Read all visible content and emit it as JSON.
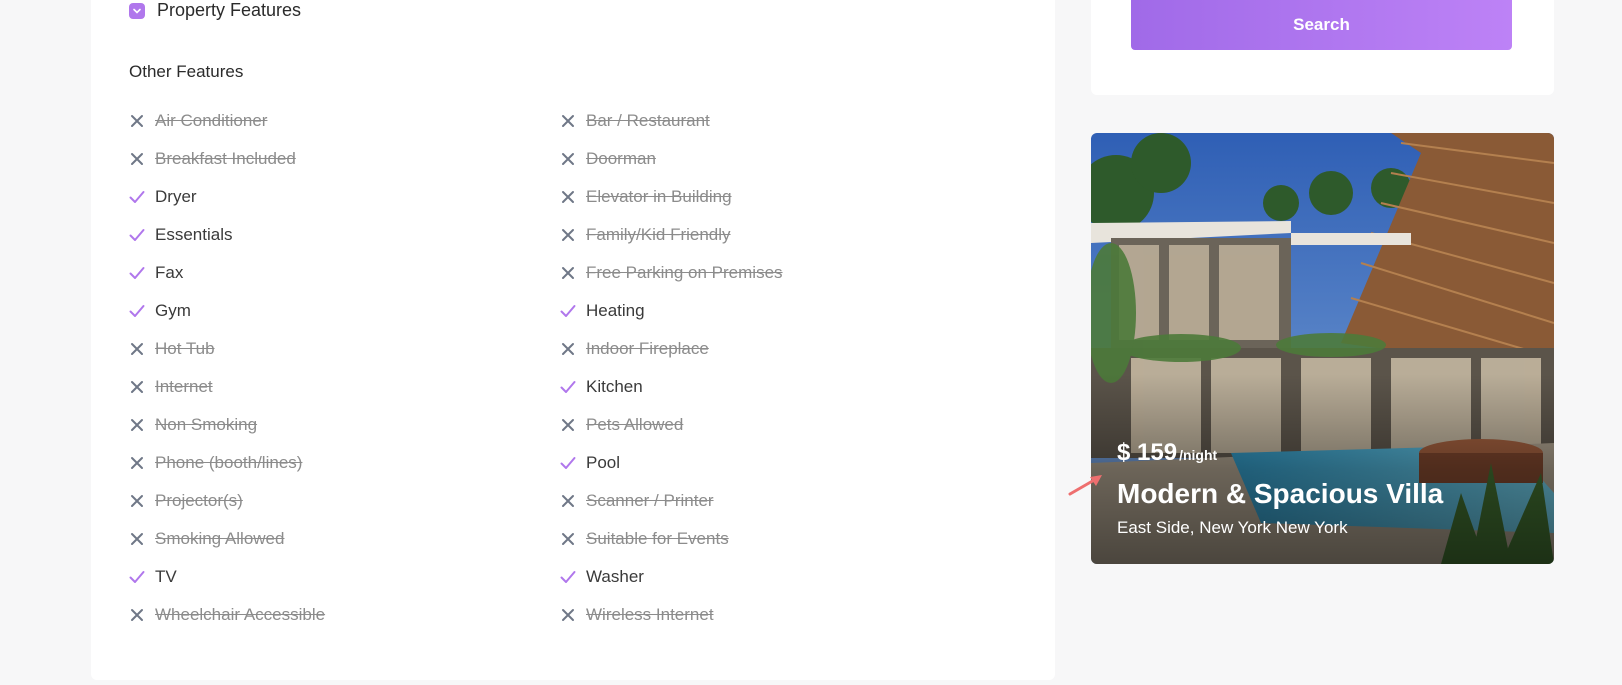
{
  "sections": {
    "property_features": "Property Features",
    "other_features": "Other Features"
  },
  "features": {
    "left": [
      {
        "label": "Air Conditioner",
        "available": false
      },
      {
        "label": "Breakfast Included",
        "available": false
      },
      {
        "label": "Dryer",
        "available": true
      },
      {
        "label": "Essentials",
        "available": true
      },
      {
        "label": "Fax",
        "available": true
      },
      {
        "label": "Gym",
        "available": true
      },
      {
        "label": "Hot Tub",
        "available": false
      },
      {
        "label": "Internet",
        "available": false
      },
      {
        "label": "Non Smoking",
        "available": false
      },
      {
        "label": "Phone (booth/lines)",
        "available": false
      },
      {
        "label": "Projector(s)",
        "available": false
      },
      {
        "label": "Smoking Allowed",
        "available": false
      },
      {
        "label": "TV",
        "available": true
      },
      {
        "label": "Wheelchair Accessible",
        "available": false
      }
    ],
    "right": [
      {
        "label": "Bar / Restaurant",
        "available": false
      },
      {
        "label": "Doorman",
        "available": false
      },
      {
        "label": "Elevator in Building",
        "available": false
      },
      {
        "label": "Family/Kid Friendly",
        "available": false
      },
      {
        "label": "Free Parking on Premises",
        "available": false
      },
      {
        "label": "Heating",
        "available": true
      },
      {
        "label": "Indoor Fireplace",
        "available": false
      },
      {
        "label": "Kitchen",
        "available": true
      },
      {
        "label": "Pets Allowed",
        "available": false
      },
      {
        "label": "Pool",
        "available": true
      },
      {
        "label": "Scanner / Printer",
        "available": false
      },
      {
        "label": "Suitable for Events",
        "available": false
      },
      {
        "label": "Washer",
        "available": true
      },
      {
        "label": "Wireless Internet",
        "available": false
      }
    ]
  },
  "search": {
    "button_label": "Search"
  },
  "listing": {
    "price": "$ 159",
    "price_unit": "/night",
    "title": "Modern & Spacious Villa",
    "address": "East Side, New York  New York"
  },
  "icons": {
    "check": "check-icon",
    "cross": "close-icon",
    "chevron": "chevron-down-icon"
  },
  "colors": {
    "accent": "#b077ec",
    "available_text": "#3a3a3a",
    "unavailable_text": "#8c8c8c"
  }
}
